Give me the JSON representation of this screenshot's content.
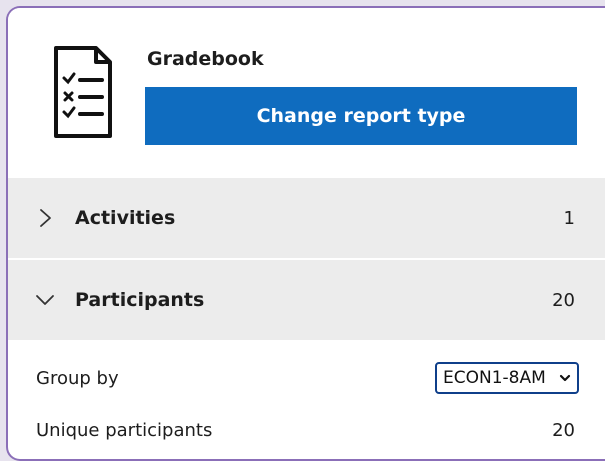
{
  "header": {
    "icon": "report-checklist-icon",
    "title": "Gradebook",
    "change_button_label": "Change report type"
  },
  "sections": {
    "activities": {
      "label": "Activities",
      "count": "1",
      "expanded": false,
      "icon": "chevron-right-icon"
    },
    "participants": {
      "label": "Participants",
      "count": "20",
      "expanded": true,
      "icon": "chevron-down-icon"
    }
  },
  "details": {
    "group_by_label": "Group by",
    "group_by_value": "ECON1-8AM",
    "unique_label": "Unique participants",
    "unique_value": "20"
  },
  "colors": {
    "accent": "#0f6cbf",
    "border": "#8b6fb8",
    "section_bg": "#ececec"
  }
}
